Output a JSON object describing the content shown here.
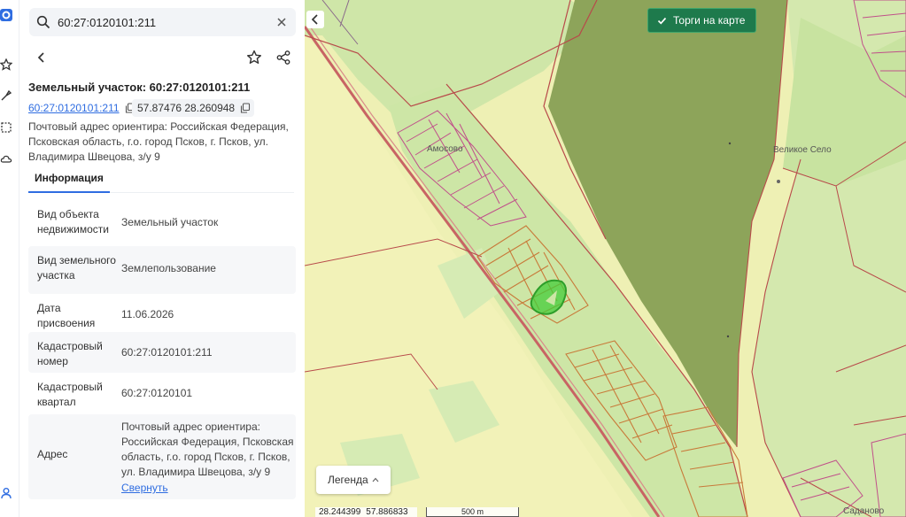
{
  "search": {
    "value": "60:27:0120101:211"
  },
  "parcel": {
    "title": "Земельный участок: 60:27:0120101:211",
    "number": "60:27:0120101:211",
    "coords": "57.87476 28.260948",
    "address": "Почтовый адрес ориентира: Российская Федерация, Псковская область, г.о. город Псков, г. Псков, ул. Владимира Швецова, з/у 9"
  },
  "tabs": {
    "info": "Информация"
  },
  "details": {
    "rows": [
      {
        "key": "Вид объекта недвижимости",
        "value": "Земельный участок"
      },
      {
        "key": "Вид земельного участка",
        "value": "Землепользование"
      },
      {
        "key": "Дата присвоения",
        "value": "11.06.2026"
      },
      {
        "key": "Кадастровый номер",
        "value": "60:27:0120101:211"
      },
      {
        "key": "Кадастровый квартал",
        "value": "60:27:0120101"
      },
      {
        "key": "Адрес",
        "value": "Почтовый адрес ориентира: Российская Федерация, Псковская область, г.о. город Псков, г. Псков, ул. Владимира Швецова, з/у 9"
      }
    ],
    "collapse_label": "Свернуть"
  },
  "map": {
    "auction_label": "Торги на карте",
    "legend_label": "Легенда",
    "status_lon": "28.244399",
    "status_lat": "57.886833",
    "scale_label": "500 m",
    "places": {
      "village1": "Амосово",
      "village2": "Великое Село",
      "village3": "Саданово"
    }
  },
  "colors": {
    "accent": "#2f6de1",
    "auction": "#1e7a4c",
    "parcel_highlight": "#2fbf2f"
  }
}
